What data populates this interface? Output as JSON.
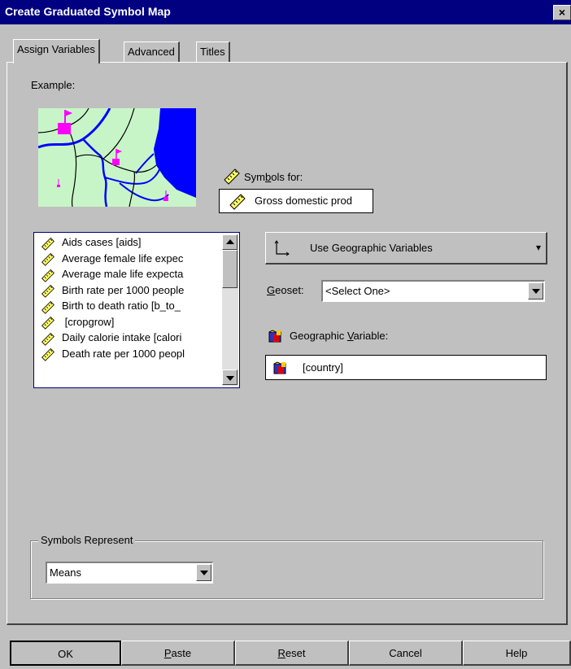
{
  "window": {
    "title": "Create Graduated Symbol Map",
    "close_glyph": "×"
  },
  "tabs": [
    {
      "label": "Assign Variables",
      "active": true
    },
    {
      "label": "Advanced",
      "active": false
    },
    {
      "label": "Titles",
      "active": false
    }
  ],
  "example": {
    "label": "Example:"
  },
  "symbols_for": {
    "label_pre": "Sym",
    "label_underlined": "b",
    "label_post": "ols for:",
    "value": "Gross domestic prod"
  },
  "variable_list": {
    "items": [
      "Aids cases [aids]",
      "Average female life expec",
      "Average male life expecta",
      "Birth rate per 1000 people",
      "Birth to death ratio [b_to_",
      " [cropgrow]",
      "Daily calorie intake [calori",
      "Death rate per 1000 peopl"
    ]
  },
  "geo_mode": {
    "label": "Use Geographic Variables",
    "arrow": "▾"
  },
  "geoset": {
    "label_underlined": "G",
    "label_post": "eoset:",
    "value": "<Select One>"
  },
  "geo_variable": {
    "label_pre": "Geographic ",
    "label_underlined": "V",
    "label_post": "ariable:",
    "value": "[country]"
  },
  "symbols_represent": {
    "legend": "Symbols Represent",
    "value": "Means"
  },
  "buttons": {
    "ok": "OK",
    "paste_u": "P",
    "paste_rest": "aste",
    "reset_u": "R",
    "reset_rest": "eset",
    "cancel": "Cancel",
    "help": "Help"
  },
  "colors": {
    "titlebar": "#000080",
    "map_land": "#c8f5c8",
    "map_water": "#0000ff",
    "map_flag": "#ff00ff",
    "dialog_bg": "#c0c0c0"
  }
}
